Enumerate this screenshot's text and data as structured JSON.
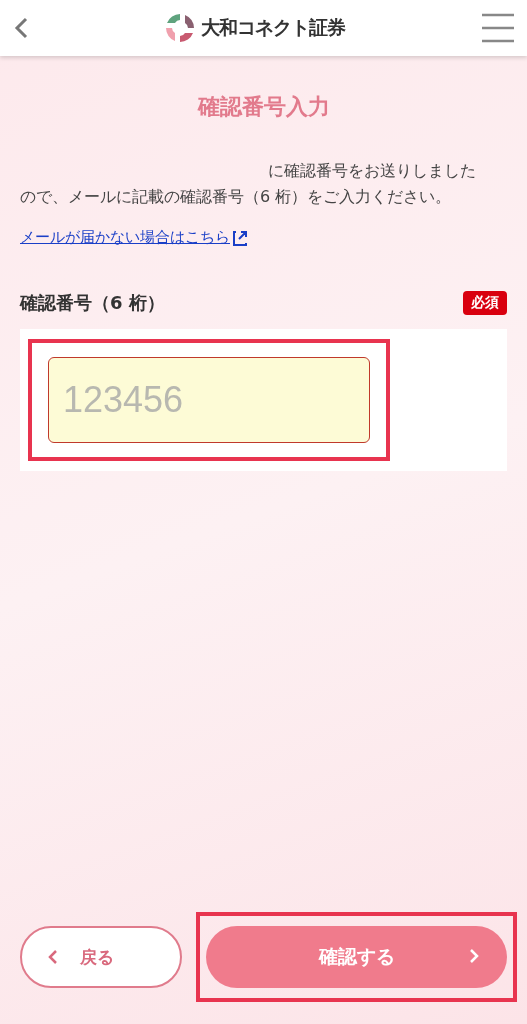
{
  "header": {
    "logo_text": "大和コネクト証券"
  },
  "title": "確認番号入力",
  "message": "に確認番号をお送りしましたので、メールに記載の確認番号（6 桁）をご入力ください。",
  "help_link": "メールが届かない場合はこちら",
  "field": {
    "label": "確認番号（6 桁）",
    "badge": "必須",
    "placeholder": "123456",
    "highlighted": true
  },
  "buttons": [
    {
      "kind": "back",
      "label": "戻る",
      "highlighted": false
    },
    {
      "kind": "next",
      "label": "確認する",
      "highlighted": true
    }
  ]
}
